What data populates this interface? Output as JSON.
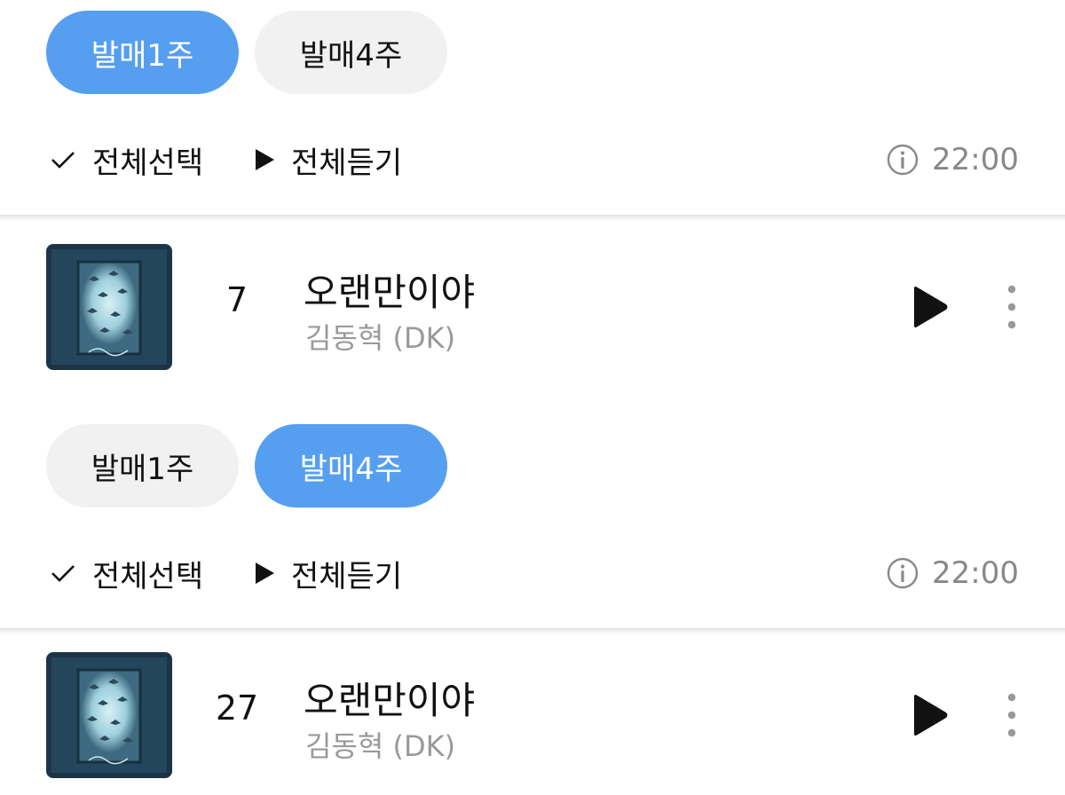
{
  "sections": [
    {
      "tabs": [
        {
          "label": "발매1주",
          "active": true
        },
        {
          "label": "발매4주",
          "active": false
        }
      ],
      "controls": {
        "select_all": "전체선택",
        "play_all": "전체듣기",
        "time": "22:00"
      },
      "track": {
        "rank": "7",
        "title": "오랜만이야",
        "artist": "김동혁 (DK)"
      }
    },
    {
      "tabs": [
        {
          "label": "발매1주",
          "active": false
        },
        {
          "label": "발매4주",
          "active": true
        }
      ],
      "controls": {
        "select_all": "전체선택",
        "play_all": "전체듣기",
        "time": "22:00"
      },
      "track": {
        "rank": "27",
        "title": "오랜만이야",
        "artist": "김동혁 (DK)"
      }
    }
  ],
  "colors": {
    "accent": "#569ff0",
    "inactive_pill": "#f1f1f1",
    "muted_text": "#999999"
  },
  "icons": {
    "check": "check-icon",
    "play": "play-icon",
    "info": "info-icon",
    "more": "more-vertical-icon"
  }
}
